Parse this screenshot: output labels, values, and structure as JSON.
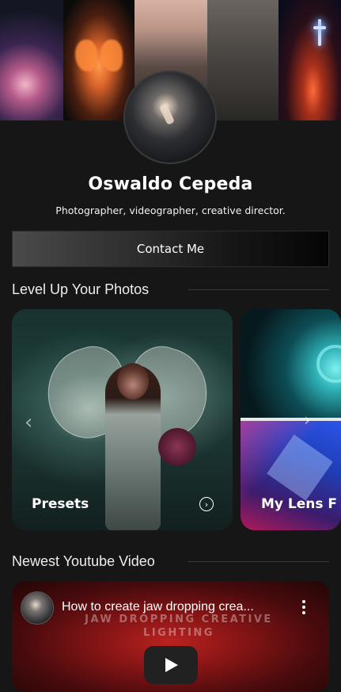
{
  "profile": {
    "name": "Oswaldo Cepeda",
    "bio": "Photographer, videographer, creative director.",
    "contact_label": "Contact Me"
  },
  "sections": {
    "photos_title": "Level Up Your Photos",
    "video_title": "Newest Youtube Video"
  },
  "cards": [
    {
      "label": "Presets"
    },
    {
      "label": "My Lens F"
    }
  ],
  "video": {
    "title": "How to create jaw dropping crea...",
    "overlay_line1": "JAW DROPPING CREATIVE",
    "overlay_line2": "LIGHTING"
  },
  "icons": {
    "left_arrow": "chevron-left-icon",
    "right_arrow": "chevron-right-icon",
    "card_action": "chevron-circle-right-icon",
    "menu": "more-vertical-icon",
    "play": "play-icon"
  },
  "colors": {
    "background": "#161616",
    "text": "#ffffff",
    "video_red": "#b8231f"
  }
}
